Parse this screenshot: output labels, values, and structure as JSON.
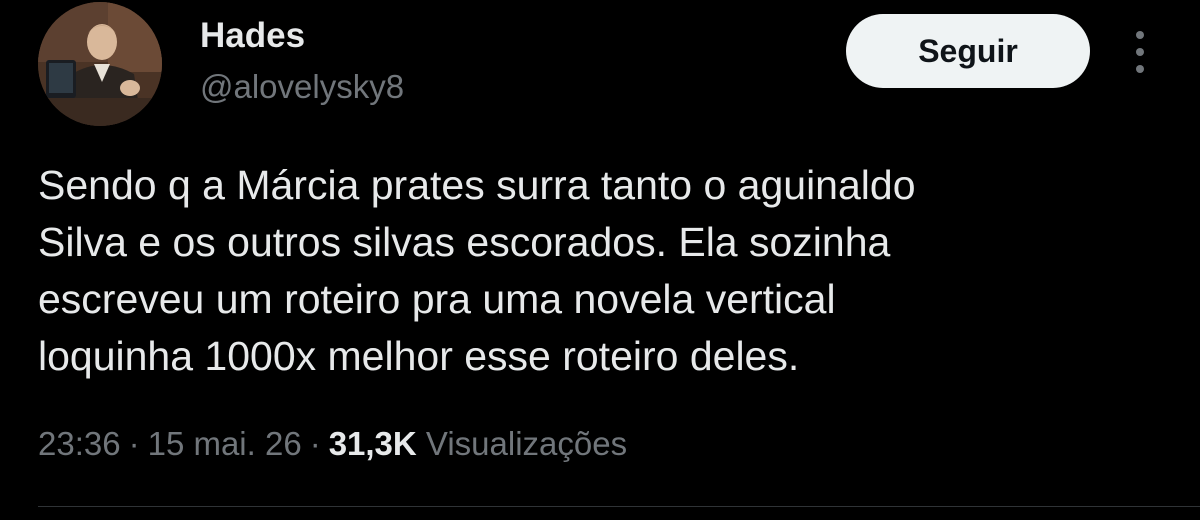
{
  "user": {
    "display_name": "Hades",
    "handle": "@alovelysky8"
  },
  "actions": {
    "follow_label": "Seguir",
    "more_icon": "more-vertical-icon"
  },
  "tweet": {
    "text_lines": [
      "Sendo q a Márcia prates surra tanto o aguinaldo",
      "Silva e os outros silvas escorados. Ela sozinha",
      "escreveu um roteiro pra uma novela vertical",
      "loquinha 1000x melhor esse roteiro deles."
    ],
    "time": "23:36",
    "date": "15 mai. 26",
    "separator": "·",
    "views_count": "31,3K",
    "views_label": "Visualizações"
  },
  "colors": {
    "background": "#000000",
    "text_primary": "#e7e9ea",
    "text_secondary": "#71767b",
    "button_bg": "#eff3f4",
    "divider": "#2f3336"
  }
}
